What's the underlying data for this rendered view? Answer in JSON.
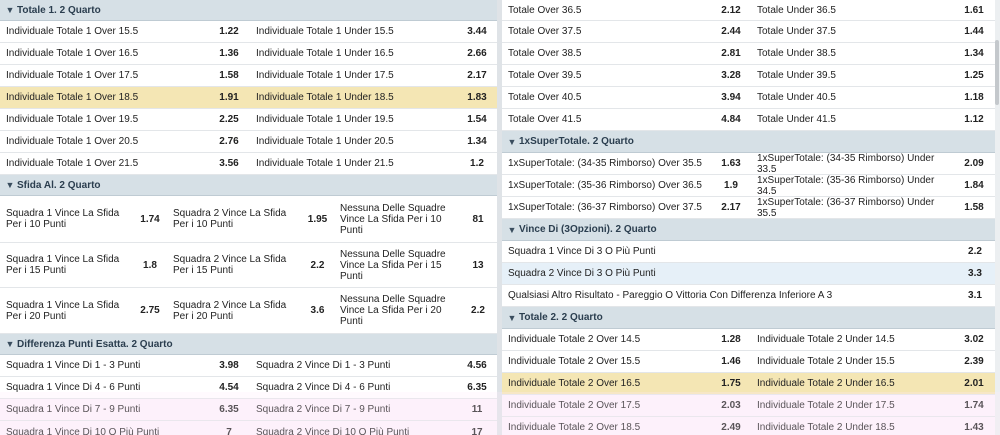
{
  "left": {
    "totale1": {
      "title": "Totale 1. 2 Quarto",
      "rows": [
        {
          "over": "Individuale Totale 1 Over 15.5",
          "over_odd": "1.22",
          "under": "Individuale Totale 1 Under 15.5",
          "under_odd": "3.44"
        },
        {
          "over": "Individuale Totale 1 Over 16.5",
          "over_odd": "1.36",
          "under": "Individuale Totale 1 Under 16.5",
          "under_odd": "2.66"
        },
        {
          "over": "Individuale Totale 1 Over 17.5",
          "over_odd": "1.58",
          "under": "Individuale Totale 1 Under 17.5",
          "under_odd": "2.17"
        },
        {
          "over": "Individuale Totale 1 Over 18.5",
          "over_odd": "1.91",
          "under": "Individuale Totale 1 Under 18.5",
          "under_odd": "1.83"
        },
        {
          "over": "Individuale Totale 1 Over 19.5",
          "over_odd": "2.25",
          "under": "Individuale Totale 1 Under 19.5",
          "under_odd": "1.54"
        },
        {
          "over": "Individuale Totale 1 Over 20.5",
          "over_odd": "2.76",
          "under": "Individuale Totale 1 Under 20.5",
          "under_odd": "1.34"
        },
        {
          "over": "Individuale Totale 1 Over 21.5",
          "over_odd": "3.56",
          "under": "Individuale Totale 1 Under 21.5",
          "under_odd": "1.2"
        }
      ]
    },
    "sfida": {
      "title": "Sfida Al. 2 Quarto",
      "rows": [
        {
          "a": "Squadra 1 Vince La Sfida Per i 10 Punti",
          "a_odd": "1.74",
          "b": "Squadra 2 Vince La Sfida Per i 10 Punti",
          "b_odd": "1.95",
          "c": "Nessuna Delle Squadre Vince La Sfida Per i 10 Punti",
          "c_odd": "81"
        },
        {
          "a": "Squadra 1 Vince La Sfida Per i 15 Punti",
          "a_odd": "1.8",
          "b": "Squadra 2 Vince La Sfida Per i 15 Punti",
          "b_odd": "2.2",
          "c": "Nessuna Delle Squadre Vince La Sfida Per i 15 Punti",
          "c_odd": "13"
        },
        {
          "a": "Squadra 1 Vince La Sfida Per i 20 Punti",
          "a_odd": "2.75",
          "b": "Squadra 2 Vince La Sfida Per i 20 Punti",
          "b_odd": "3.6",
          "c": "Nessuna Delle Squadre Vince La Sfida Per i 20 Punti",
          "c_odd": "2.2"
        }
      ]
    },
    "differenza": {
      "title": "Differenza Punti Esatta. 2 Quarto",
      "rows": [
        {
          "over": "Squadra 1 Vince Di 1 - 3 Punti",
          "over_odd": "3.98",
          "under": "Squadra 2 Vince Di 1 - 3 Punti",
          "under_odd": "4.56"
        },
        {
          "over": "Squadra 1 Vince Di 4 - 6 Punti",
          "over_odd": "4.54",
          "under": "Squadra 2 Vince Di 4 - 6 Punti",
          "under_odd": "6.35"
        },
        {
          "over": "Squadra 1 Vince Di 7 - 9 Punti",
          "over_odd": "6.35",
          "under": "Squadra 2 Vince Di 7 - 9 Punti",
          "under_odd": "11"
        },
        {
          "over": "Squadra 1 Vince Di 10 O Più Punti",
          "over_odd": "7",
          "under": "Squadra 2 Vince Di 10 O Più Punti",
          "under_odd": "17"
        }
      ]
    }
  },
  "right": {
    "totale_cont": {
      "rows": [
        {
          "over": "Totale Over 36.5",
          "over_odd": "2.12",
          "under": "Totale Under 36.5",
          "under_odd": "1.61"
        },
        {
          "over": "Totale Over 37.5",
          "over_odd": "2.44",
          "under": "Totale Under 37.5",
          "under_odd": "1.44"
        },
        {
          "over": "Totale Over 38.5",
          "over_odd": "2.81",
          "under": "Totale Under 38.5",
          "under_odd": "1.34"
        },
        {
          "over": "Totale Over 39.5",
          "over_odd": "3.28",
          "under": "Totale Under 39.5",
          "under_odd": "1.25"
        },
        {
          "over": "Totale Over 40.5",
          "over_odd": "3.94",
          "under": "Totale Under 40.5",
          "under_odd": "1.18"
        },
        {
          "over": "Totale Over 41.5",
          "over_odd": "4.84",
          "under": "Totale Under 41.5",
          "under_odd": "1.12"
        }
      ]
    },
    "super": {
      "title": "1xSuperTotale. 2 Quarto",
      "rows": [
        {
          "over": "1xSuperTotale: (34-35 Rimborso) Over 35.5",
          "over_odd": "1.63",
          "under": "1xSuperTotale: (34-35 Rimborso) Under 33.5",
          "under_odd": "2.09"
        },
        {
          "over": "1xSuperTotale: (35-36 Rimborso) Over 36.5",
          "over_odd": "1.9",
          "under": "1xSuperTotale: (35-36 Rimborso) Under 34.5",
          "under_odd": "1.84"
        },
        {
          "over": "1xSuperTotale: (36-37 Rimborso) Over 37.5",
          "over_odd": "2.17",
          "under": "1xSuperTotale: (36-37 Rimborso) Under 35.5",
          "under_odd": "1.58"
        }
      ]
    },
    "vince": {
      "title": "Vince Di (3Opzioni). 2 Quarto",
      "rows": [
        {
          "label": "Squadra 1 Vince Di 3 O Più Punti",
          "odd": "2.2"
        },
        {
          "label": "Squadra 2 Vince Di 3 O Più Punti",
          "odd": "3.3"
        },
        {
          "label": "Qualsiasi Altro Risultato - Pareggio O Vittoria Con Differenza Inferiore A 3",
          "odd": "3.1"
        }
      ]
    },
    "totale2": {
      "title": "Totale 2. 2 Quarto",
      "rows": [
        {
          "over": "Individuale Totale 2 Over 14.5",
          "over_odd": "1.28",
          "under": "Individuale Totale 2 Under 14.5",
          "under_odd": "3.02"
        },
        {
          "over": "Individuale Totale 2 Over 15.5",
          "over_odd": "1.46",
          "under": "Individuale Totale 2 Under 15.5",
          "under_odd": "2.39"
        },
        {
          "over": "Individuale Totale 2 Over 16.5",
          "over_odd": "1.75",
          "under": "Individuale Totale 2 Under 16.5",
          "under_odd": "2.01"
        },
        {
          "over": "Individuale Totale 2 Over 17.5",
          "over_odd": "2.03",
          "under": "Individuale Totale 2 Under 17.5",
          "under_odd": "1.74"
        },
        {
          "over": "Individuale Totale 2 Over 18.5",
          "over_odd": "2.49",
          "under": "Individuale Totale 2 Under 18.5",
          "under_odd": "1.43"
        }
      ]
    }
  },
  "icons": {
    "collapse": "chevron-down-icon"
  },
  "colors": {
    "header_bg": "#d6e0e6",
    "highlight": "#f4e6b4",
    "selected_blue": "#e6f0f8"
  }
}
